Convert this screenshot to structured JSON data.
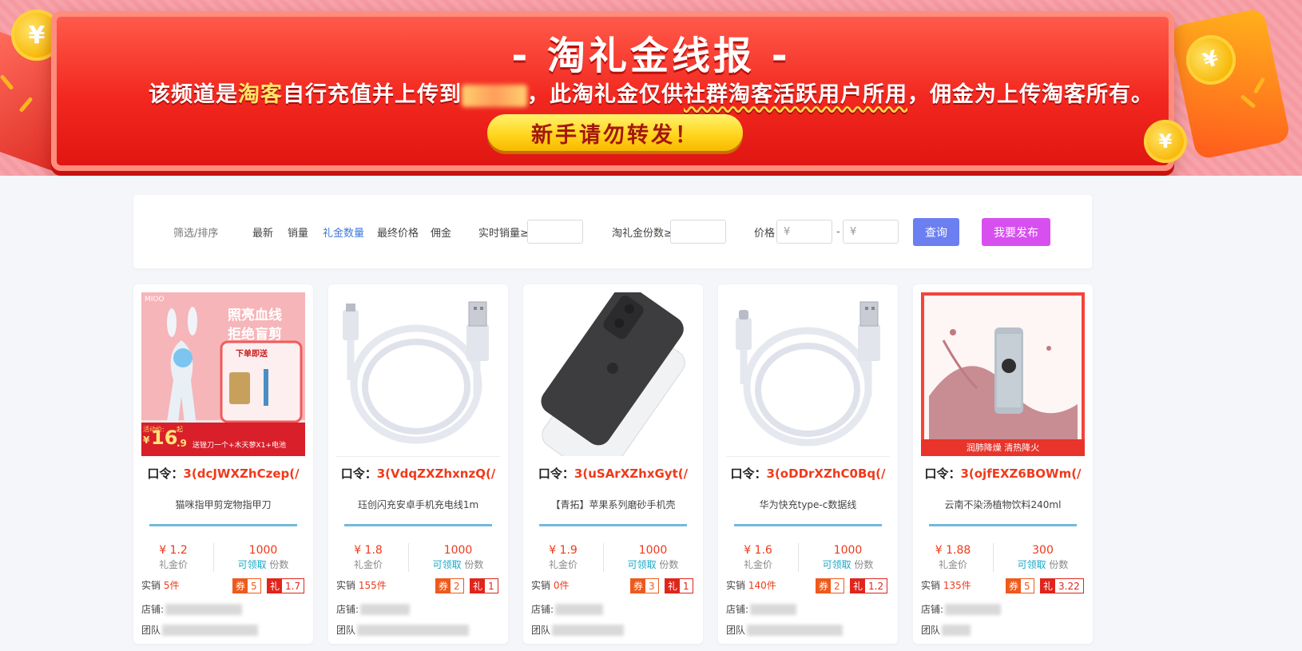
{
  "banner": {
    "title": "- 淘礼金线报 -",
    "desc_part1": "该频道是",
    "desc_highlight": "淘客",
    "desc_part2": "自行充值并上传到",
    "desc_part3": "，此淘礼金仅供",
    "desc_underlined": "社群淘客活跃用户所用",
    "desc_part4": "，佣金为上传淘客所有。",
    "cta": "新手请勿转发！",
    "coin_symbol": "¥"
  },
  "filter": {
    "label": "筛选/排序",
    "sort_items": [
      "最新",
      "销量",
      "礼金数量",
      "最终价格",
      "佣金"
    ],
    "active_sort": "礼金数量",
    "sales_label": "实时销量≥",
    "gift_count_label": "淘礼金份数≥",
    "price_label": "价格",
    "price_min_placeholder": "¥",
    "price_sep": "-",
    "price_max_placeholder": "¥",
    "query_button": "查询",
    "publish_button": "我要发布"
  },
  "card_labels": {
    "code_prefix": "口令：",
    "price_caption": "礼金价",
    "claim_link": "可领取",
    "count_caption": "份数",
    "sold_prefix": "实销",
    "coupon_key": "券",
    "gift_key": "礼",
    "shop_label": "店铺:",
    "team_label": "团队"
  },
  "products": [
    {
      "code": "3(dcJWXZhCzep(/",
      "name": "猫咪指甲剪宠物指甲刀",
      "price": "¥ 1.2",
      "count": "1000",
      "sold": "5件",
      "coupon": "5",
      "gift": "1.7",
      "thumb": {
        "brand": "MIOO",
        "headline1": "照亮血线",
        "headline2": "拒绝盲剪",
        "gift_tag": "下单即送",
        "promo_label": "活动价:",
        "promo_price": "16",
        "promo_cents": ".9",
        "promo_text": "送锉刀一个+木天蓼X1+电池",
        "promo_currency": "¥",
        "promo_unit": "起"
      }
    },
    {
      "code": "3(VdqZXZhxnzQ(/",
      "name": "珏创闪充安卓手机充电线1m",
      "price": "¥ 1.8",
      "count": "1000",
      "sold": "155件",
      "coupon": "2",
      "gift": "1"
    },
    {
      "code": "3(uSArXZhxGyt(/",
      "name": "【青拓】苹果系列磨砂手机壳",
      "price": "¥ 1.9",
      "count": "1000",
      "sold": "0件",
      "coupon": "3",
      "gift": "1"
    },
    {
      "code": "3(oDDrXZhC0Bq(/",
      "name": "华为快充type-c数据线",
      "price": "¥ 1.6",
      "count": "1000",
      "sold": "140件",
      "coupon": "2",
      "gift": "1.2"
    },
    {
      "code": "3(ojfEXZ6BOWm(/",
      "name": "云南不染汤植物饮料240ml",
      "price": "¥ 1.88",
      "count": "300",
      "sold": "135件",
      "coupon": "5",
      "gift": "3.22",
      "thumb": {
        "caption": "润肺降燥 清热降火"
      }
    }
  ],
  "colors": {
    "accent_red": "#ee3a1c",
    "link_blue": "#3e78d8",
    "teal": "#19a7c6",
    "query_btn": "#6b7ff0",
    "publish_btn": "#d84ff0",
    "divider_blue": "#72b9dd"
  }
}
